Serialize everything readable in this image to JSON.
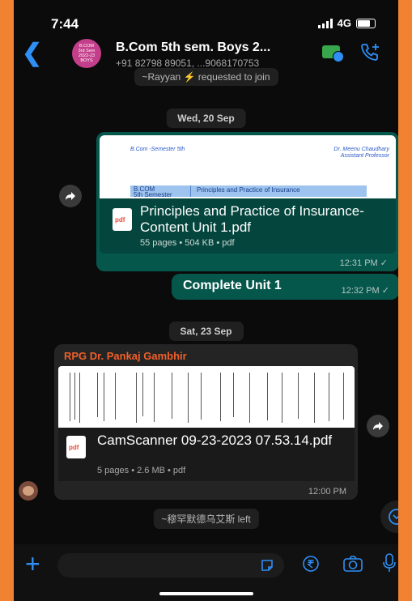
{
  "status_bar": {
    "time": "7:44",
    "network": "4G"
  },
  "header": {
    "avatar_lines": [
      "B.COM",
      "3rd Sem",
      "2022-23",
      "BOYS"
    ],
    "title": "B.Com 5th sem. Boys 2...",
    "subtitle": "+91 82798 89051, ...9068170753"
  },
  "messages": {
    "join_notice": "~Rayyan ⚡ requested to join",
    "date1": "Wed, 20 Sep",
    "doc1": {
      "preview_left": "B.Com -Semester 5th",
      "preview_right_1": "Dr. Meenu Chaudhary",
      "preview_right_2": "Assistant Professor",
      "preview_band_a": "B.COM",
      "preview_band_a2": "5th Semester",
      "preview_band_b": "Principles and Practice of Insurance",
      "icon_label": "pdf",
      "name": "Principles and Practice of Insurance- Content Unit 1.pdf",
      "meta": "55 pages • 504 KB • pdf",
      "time": "12:31 PM ✓"
    },
    "text1": {
      "text": "Complete Unit 1",
      "time": "12:32 PM ✓"
    },
    "date2": "Sat, 23 Sep",
    "doc2": {
      "sender": "RPG  Dr. Pankaj Gambhir",
      "icon_label": "pdf",
      "name": "CamScanner 09-23-2023 07.53.14.pdf",
      "meta": "5 pages • 2.6 MB • pdf",
      "time": "12:00 PM"
    },
    "left_notice": "~穆罕默德乌艾斯 left"
  },
  "colors": {
    "outgoing": "#05574c",
    "incoming": "#242424",
    "accent": "#2f8ff5",
    "sender": "#f0602a",
    "frame": "#f08232"
  },
  "icons": [
    "back-arrow-icon",
    "video-call-icon",
    "add-call-icon",
    "forward-icon",
    "scroll-down-icon",
    "plus-icon",
    "sticker-icon",
    "rupee-icon",
    "camera-icon",
    "mic-icon"
  ]
}
